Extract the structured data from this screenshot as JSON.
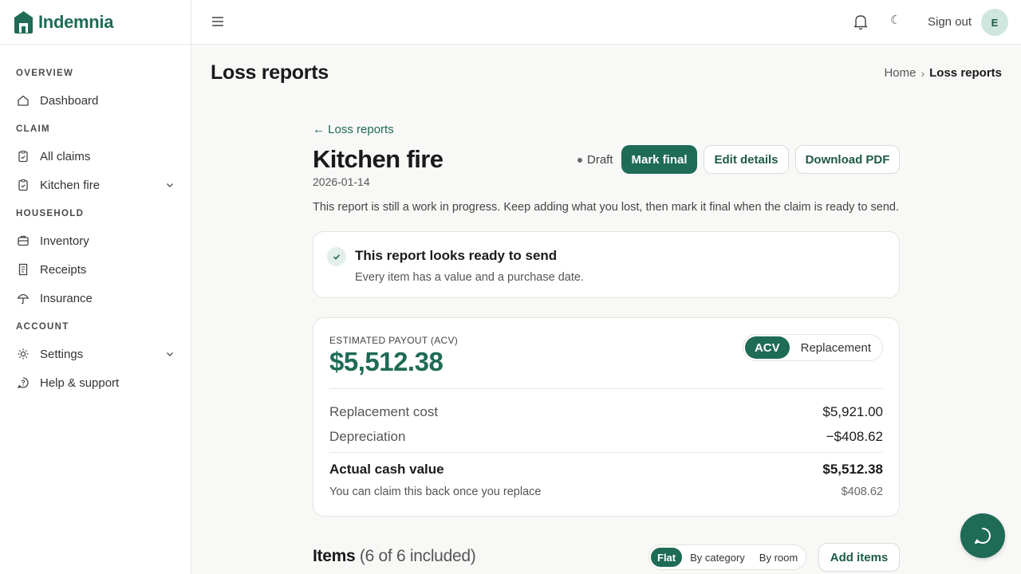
{
  "app": {
    "name": "Indemnia"
  },
  "colors": {
    "accent": "#1e6b56",
    "avatar_bg": "#cfe6de"
  },
  "sidebar": {
    "sections": [
      {
        "title": "OVERVIEW",
        "items": [
          {
            "label": "Dashboard",
            "icon": "home-icon"
          }
        ]
      },
      {
        "title": "CLAIM",
        "items": [
          {
            "label": "All claims",
            "icon": "clipboard-icon"
          },
          {
            "label": "Kitchen fire",
            "icon": "clipboard-icon",
            "expandable": true
          }
        ]
      },
      {
        "title": "HOUSEHOLD",
        "items": [
          {
            "label": "Inventory",
            "icon": "box-icon"
          },
          {
            "label": "Receipts",
            "icon": "receipt-icon"
          },
          {
            "label": "Insurance",
            "icon": "umbrella-icon"
          }
        ]
      },
      {
        "title": "ACCOUNT",
        "items": [
          {
            "label": "Settings",
            "icon": "gear-icon",
            "expandable": true
          },
          {
            "label": "Help & support",
            "icon": "help-chat-icon"
          }
        ]
      }
    ]
  },
  "topbar": {
    "sign_out": "Sign out",
    "avatar_initial": "E",
    "theme_glyph": "☾"
  },
  "page": {
    "title": "Loss reports",
    "breadcrumb": {
      "home": "Home",
      "separator": "›",
      "current": "Loss reports"
    }
  },
  "report": {
    "back_link": "← Loss reports",
    "title": "Kitchen fire",
    "date": "2026-01-14",
    "status": "Draft",
    "actions": {
      "mark_final": "Mark final",
      "edit_details": "Edit details",
      "download_pdf": "Download PDF"
    },
    "intro": "This report is still a work in progress. Keep adding what you lost, then mark it final when the claim is ready to send."
  },
  "ready_card": {
    "heading": "This report looks ready to send",
    "text": "Every item has a value and a purchase date."
  },
  "payout": {
    "label": "ESTIMATED PAYOUT (ACV)",
    "amount": "$5,512.38",
    "toggle": {
      "selected": "ACV",
      "other": "Replacement"
    },
    "rows": [
      {
        "label": "Replacement cost",
        "value": "$5,921.00"
      },
      {
        "label": "Depreciation",
        "value": "−$408.62"
      }
    ],
    "total": {
      "label": "Actual cash value",
      "value": "$5,512.38"
    },
    "note": {
      "label": "You can claim this back once you replace",
      "value": "$408.62"
    }
  },
  "items": {
    "heading": "Items",
    "count": "(6 of 6 included)",
    "views": {
      "selected": "Flat",
      "by_category": "By category",
      "by_room": "By room"
    },
    "add_button": "Add items"
  }
}
